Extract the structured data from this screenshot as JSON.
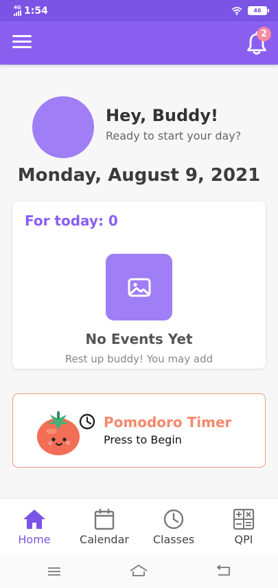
{
  "status_bar": {
    "network": "4G",
    "time": "1:54",
    "battery": "46"
  },
  "app_bar": {
    "notification_count": "2"
  },
  "greeting": {
    "title": "Hey, Buddy!",
    "subtitle": "Ready to start your day?"
  },
  "date": "Monday, August 9, 2021",
  "events_card": {
    "title": "For today: 0",
    "empty_title": "No Events Yet",
    "empty_subtitle": "Rest up buddy! You may add"
  },
  "pomodoro": {
    "title": "Pomodoro Timer",
    "subtitle": "Press to Begin"
  },
  "bottom_nav": {
    "items": [
      {
        "label": "Home",
        "icon": "home-icon",
        "active": true
      },
      {
        "label": "Calendar",
        "icon": "calendar-icon",
        "active": false
      },
      {
        "label": "Classes",
        "icon": "clock-icon",
        "active": false
      },
      {
        "label": "QPI",
        "icon": "calculator-icon",
        "active": false
      }
    ]
  },
  "colors": {
    "primary": "#8a5ff0",
    "status_bar": "#7b54e6",
    "accent_light": "#a07ef5",
    "pomodoro_accent": "#f4896b",
    "badge": "#f58aa0"
  }
}
